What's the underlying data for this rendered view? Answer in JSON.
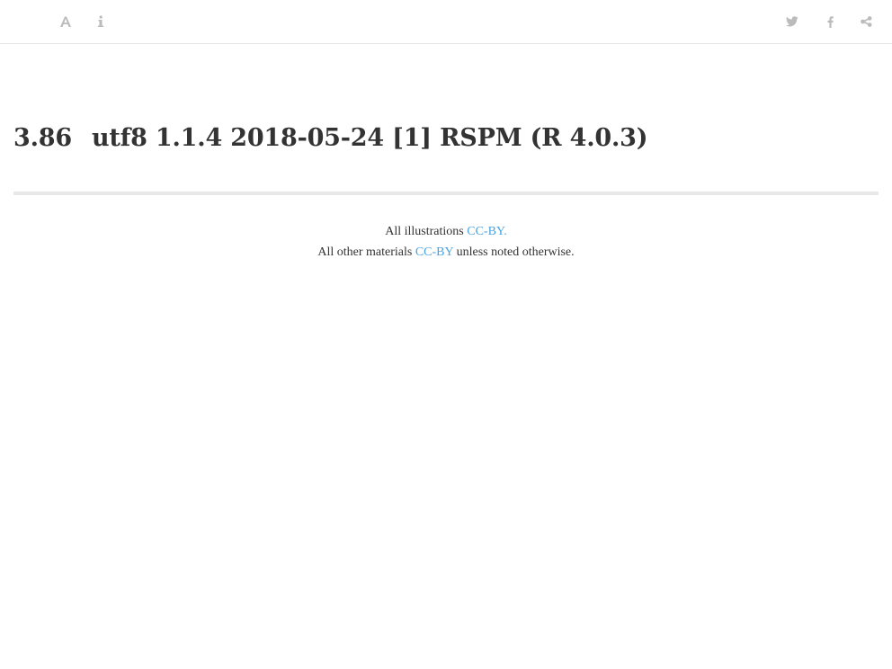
{
  "toolbar": {
    "left_icons": [
      "font-settings-icon",
      "info-icon"
    ],
    "right_icons": [
      "twitter-icon",
      "facebook-icon",
      "share-icon"
    ],
    "icon_color": "#bbbbbb"
  },
  "heading": {
    "number": "3.86",
    "title": "utf8 1.1.4 2018-05-24 [1] RSPM (R 4.0.3)"
  },
  "footer": {
    "line1_prefix": "All illustrations ",
    "line1_link": "CC-BY.",
    "line2_prefix": "All other materials ",
    "line2_link": "CC-BY",
    "line2_suffix": " unless noted otherwise.",
    "link_color": "#4aa3df"
  }
}
